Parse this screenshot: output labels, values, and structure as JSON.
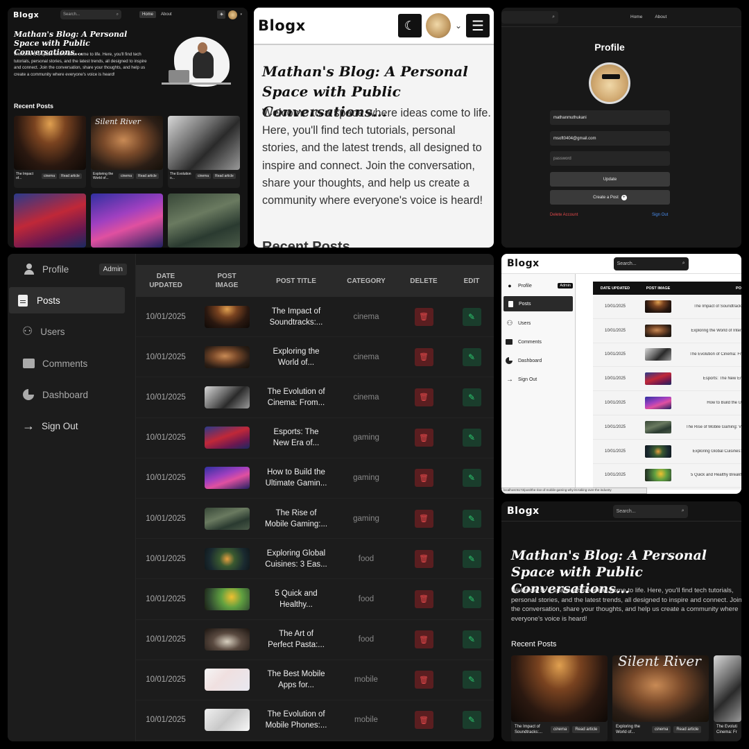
{
  "blog": {
    "logo": "Blogx",
    "search_placeholder": "Search...",
    "nav": [
      "Home",
      "About"
    ],
    "hero_title": "Mathan's Blog: A Personal Space with Public Conversations...",
    "hero_text": "Welcome to a space where ideas come to life. Here, you'll find tech tutorials, personal stories, and the latest trends, all designed to inspire and connect. Join the conversation, share your thoughts, and help us create a community where everyone's voice is heard!",
    "recent_posts": "Recent Posts",
    "recent_posts_cut": "Recent Posts",
    "read_article": "Read article",
    "cards": [
      {
        "title": "The Impact of Soundtracks:...",
        "title_short": "The Impact of...",
        "category": "cinema"
      },
      {
        "title": "Exploring the World of...",
        "title_short": "Exploring the World of...",
        "category": "cinema"
      },
      {
        "title": "The Evolution of Cinema: Fr...",
        "title_short": "The Evolution o...",
        "category": "cinema"
      }
    ]
  },
  "profile": {
    "title": "Profile",
    "username": "mathanmuthukani",
    "email": "msoft0404@gmail.com",
    "password_placeholder": "password",
    "update_label": "Update",
    "create_label": "Create a Post",
    "delete_label": "Delete Account",
    "signout_label": "Sign Out"
  },
  "sidebar": {
    "admin_badge": "Admin",
    "items": [
      {
        "label": "Profile",
        "icon": "user-icon"
      },
      {
        "label": "Posts",
        "icon": "document-icon"
      },
      {
        "label": "Users",
        "icon": "users-icon"
      },
      {
        "label": "Comments",
        "icon": "comment-icon"
      },
      {
        "label": "Dashboard",
        "icon": "pie-chart-icon"
      },
      {
        "label": "Sign Out",
        "icon": "arrow-right-icon"
      }
    ]
  },
  "posts_table": {
    "headers": [
      "DATE UPDATED",
      "POST IMAGE",
      "POST TITLE",
      "CATEGORY",
      "DELETE",
      "EDIT"
    ],
    "header_date_1": "DATE",
    "header_date_2": "UPDATED",
    "header_image_1": "POST",
    "header_image_2": "IMAGE",
    "rows": [
      {
        "date": "10/01/2025",
        "title_1": "The Impact of",
        "title_2": "Soundtracks:...",
        "category": "cinema",
        "thumb": "concert"
      },
      {
        "date": "10/01/2025",
        "title_1": "Exploring the",
        "title_2": "World of...",
        "category": "cinema",
        "thumb": "portrait"
      },
      {
        "date": "10/01/2025",
        "title_1": "The Evolution of",
        "title_2": "Cinema: From...",
        "category": "cinema",
        "thumb": "bw"
      },
      {
        "date": "10/01/2025",
        "title_1": "Esports: The",
        "title_2": "New Era of...",
        "category": "gaming",
        "thumb": "esports"
      },
      {
        "date": "10/01/2025",
        "title_1": "How to Build the",
        "title_2": "Ultimate Gamin...",
        "category": "gaming",
        "thumb": "gaming"
      },
      {
        "date": "10/01/2025",
        "title_1": "The Rise of",
        "title_2": "Mobile Gaming:...",
        "category": "gaming",
        "thumb": "mobile"
      },
      {
        "date": "10/01/2025",
        "title_1": "Exploring Global",
        "title_2": "Cuisines: 3 Eas...",
        "category": "food",
        "thumb": "food1"
      },
      {
        "date": "10/01/2025",
        "title_1": "5 Quick and",
        "title_2": "Healthy...",
        "category": "food",
        "thumb": "food2"
      },
      {
        "date": "10/01/2025",
        "title_1": "The Art of",
        "title_2": "Perfect Pasta:...",
        "category": "food",
        "thumb": "pasta"
      },
      {
        "date": "10/01/2025",
        "title_1": "The Best Mobile",
        "title_2": "Apps for...",
        "category": "mobile",
        "thumb": "apps"
      },
      {
        "date": "10/01/2025",
        "title_1": "The Evolution of",
        "title_2": "Mobile Phones:...",
        "category": "mobile",
        "thumb": "phones"
      }
    ]
  },
  "light_table": {
    "rows": [
      {
        "date": "10/01/2025",
        "title": "The Impact of Soundtrack",
        "thumb": "concert"
      },
      {
        "date": "10/01/2025",
        "title": "Exploring the World of Inter",
        "thumb": "portrait"
      },
      {
        "date": "10/01/2025",
        "title": "The Evolution of Cinema: Fr",
        "thumb": "bw"
      },
      {
        "date": "10/01/2025",
        "title": "Esports: The New Er",
        "thumb": "esports"
      },
      {
        "date": "10/01/2025",
        "title": "How to Build the U",
        "thumb": "gaming"
      },
      {
        "date": "10/01/2025",
        "title": "The Rise of Mobile Gaming: V",
        "thumb": "mobile"
      },
      {
        "date": "10/01/2025",
        "title": "Exploring Global Cuisines:",
        "thumb": "food1"
      },
      {
        "date": "10/01/2025",
        "title": "5 Quick and Healthy Breakf",
        "thumb": "food2"
      }
    ],
    "status_url": "localhost:5173/post/the-rise-of-mobile-gaming-why-its-taking-over-the-industry"
  },
  "bottom": {
    "cards": [
      {
        "title": "The Impact of Soundtracks:...",
        "category": "cinema"
      },
      {
        "title": "Exploring the World of...",
        "category": "cinema"
      },
      {
        "title": "The Evoluti Cinema: Fr",
        "category": ""
      }
    ],
    "card_art_text": "Silent River"
  },
  "colors": {
    "dark_bg": "#151515",
    "accent_red": "#e0484a",
    "accent_green": "#2ecc71",
    "link_blue": "#4a8ef0"
  }
}
